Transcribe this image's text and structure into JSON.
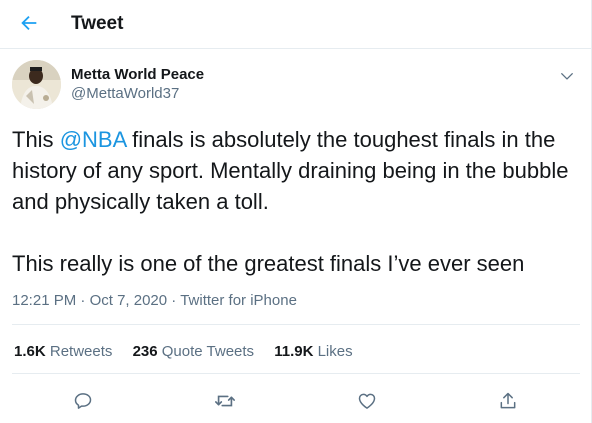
{
  "header": {
    "title": "Tweet",
    "back_icon": "arrow-left-icon"
  },
  "author": {
    "name": "Metta World Peace",
    "handle": "@MettaWorld37",
    "avatar_icon": "avatar",
    "more_icon": "chevron-down-icon"
  },
  "tweet": {
    "text_before": "This ",
    "mention": "@NBA",
    "text_after": " finals is absolutely the toughest finals in the history of any sport. Mentally draining being in the bubble and physically taken a toll.\n\nThis really is one of the greatest finals I’ve ever seen"
  },
  "meta": {
    "time": "12:21 PM",
    "sep1": " · ",
    "date": "Oct 7, 2020",
    "sep2": " · ",
    "source": "Twitter for iPhone"
  },
  "stats": {
    "retweets": {
      "count": "1.6K",
      "label": "Retweets"
    },
    "quotes": {
      "count": "236",
      "label": "Quote Tweets"
    },
    "likes": {
      "count": "11.9K",
      "label": "Likes"
    }
  },
  "actions": [
    "reply-icon",
    "retweet-icon",
    "like-icon",
    "share-icon"
  ],
  "colors": {
    "accent": "#1da1f2",
    "mention": "#1b95e0",
    "muted": "#5b7083",
    "border": "#e6ecf0"
  }
}
